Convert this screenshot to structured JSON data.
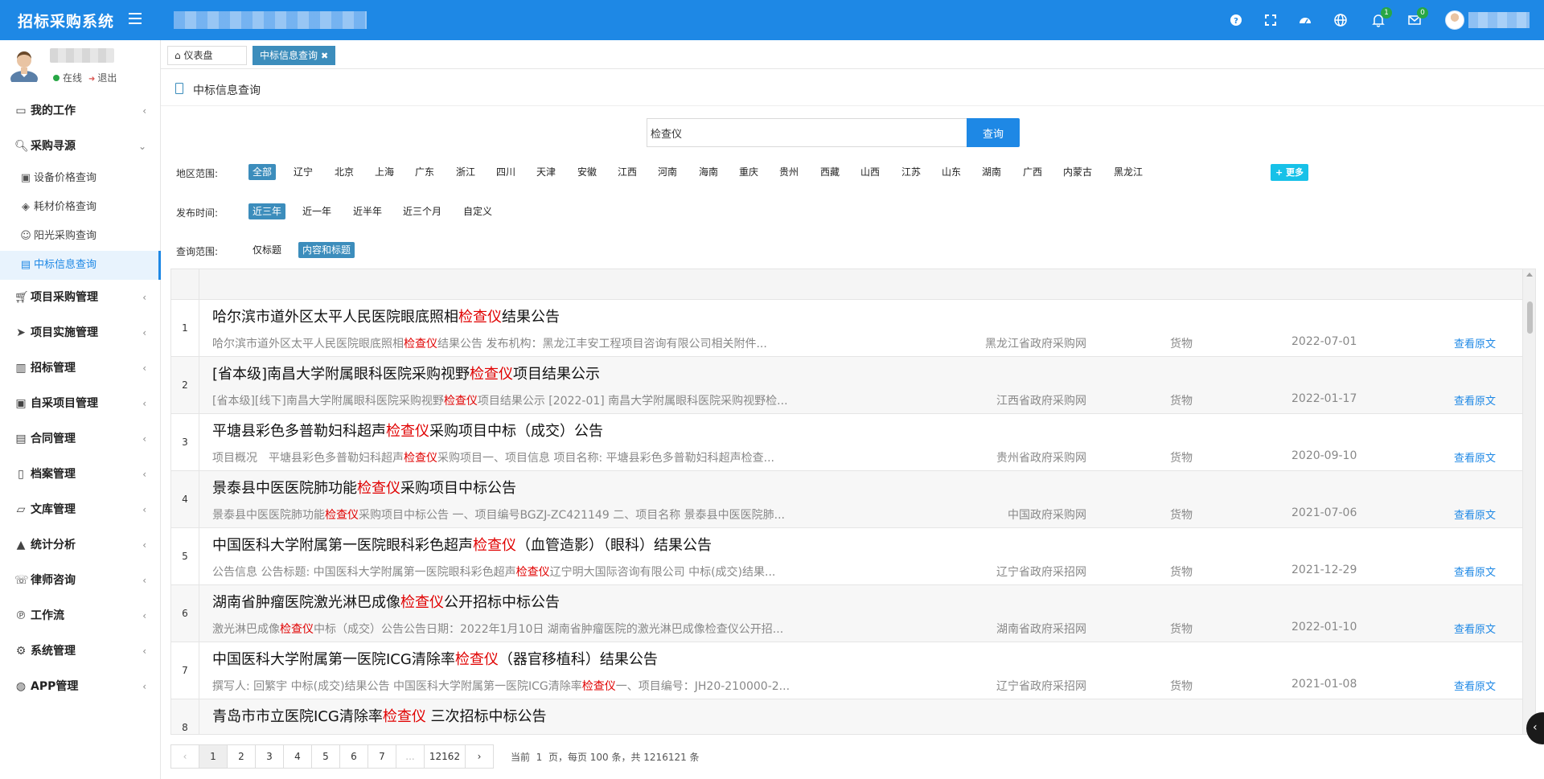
{
  "app": {
    "title": "招标采购系统"
  },
  "topbar": {
    "icons": [
      "help-icon",
      "fullscreen-icon",
      "dashboard-icon",
      "globe-icon",
      "bell-icon",
      "mail-icon"
    ],
    "bell_badge": "1",
    "mail_badge": "0"
  },
  "user": {
    "status_online": "在线",
    "logout": "退出"
  },
  "sidebar": {
    "items": [
      {
        "label": "我的工作",
        "icon": "monitor-icon"
      },
      {
        "label": "采购寻源",
        "icon": "search-icon"
      },
      {
        "label": "项目采购管理",
        "icon": "cart-icon"
      },
      {
        "label": "项目实施管理",
        "icon": "send-icon"
      },
      {
        "label": "招标管理",
        "icon": "map-icon"
      },
      {
        "label": "自采项目管理",
        "icon": "id-card-icon"
      },
      {
        "label": "合同管理",
        "icon": "doc-icon"
      },
      {
        "label": "档案管理",
        "icon": "archive-icon"
      },
      {
        "label": "文库管理",
        "icon": "folder-icon"
      },
      {
        "label": "统计分析",
        "icon": "chart-icon"
      },
      {
        "label": "律师咨询",
        "icon": "phone-icon"
      },
      {
        "label": "工作流",
        "icon": "workflow-icon"
      },
      {
        "label": "系统管理",
        "icon": "gear-icon"
      },
      {
        "label": "APP管理",
        "icon": "globe-icon"
      }
    ],
    "sub_items": [
      {
        "label": "设备价格查询",
        "icon": "camera-icon"
      },
      {
        "label": "耗材价格查询",
        "icon": "layers-icon"
      },
      {
        "label": "阳光采购查询",
        "icon": "smile-icon"
      },
      {
        "label": "中标信息查询",
        "icon": "book-icon"
      }
    ]
  },
  "tabs": [
    {
      "label": "仪表盘",
      "icon": "home-icon"
    },
    {
      "label": "中标信息查询",
      "close": "✖"
    }
  ],
  "page": {
    "title": "中标信息查询"
  },
  "search": {
    "value": "检查仪",
    "button": "查询"
  },
  "filters": {
    "region_label": "地区范围:",
    "regions": [
      "全部",
      "辽宁",
      "北京",
      "上海",
      "广东",
      "浙江",
      "四川",
      "天津",
      "安徽",
      "江西",
      "河南",
      "海南",
      "重庆",
      "贵州",
      "西藏",
      "山西",
      "江苏",
      "山东",
      "湖南",
      "广西",
      "内蒙古",
      "黑龙江"
    ],
    "more": "+ 更多",
    "time_label": "发布时间:",
    "times": [
      "近三年",
      "近一年",
      "近半年",
      "近三个月",
      "自定义"
    ],
    "scope_label": "查询范围:",
    "scopes": [
      "仅标题",
      "内容和标题"
    ]
  },
  "table": {
    "view_label": "查看原文",
    "rows": [
      {
        "num": "1",
        "title_pre": "哈尔滨市道外区太平人民医院眼底照相",
        "title_hl": "检查仪",
        "title_post": "结果公告",
        "desc_pre": "哈尔滨市道外区太平人民医院眼底照相",
        "desc_hl": "检查仪",
        "desc_post": "结果公告 发布机构：黑龙江丰安工程项目咨询有限公司相关附件...",
        "source": "黑龙江省政府采购网",
        "category": "货物",
        "date": "2022-07-01"
      },
      {
        "num": "2",
        "title_pre": "[省本级]南昌大学附属眼科医院采购视野",
        "title_hl": "检查仪",
        "title_post": "项目结果公示",
        "desc_pre": "[省本级][线下]南昌大学附属眼科医院采购视野",
        "desc_hl": "检查仪",
        "desc_post": "项目结果公示 [2022-01] 南昌大学附属眼科医院采购视野检...",
        "source": "江西省政府采购网",
        "category": "货物",
        "date": "2022-01-17"
      },
      {
        "num": "3",
        "title_pre": "平塘县彩色多普勒妇科超声",
        "title_hl": "检查仪",
        "title_post": "采购项目中标（成交）公告",
        "desc_pre": "项目概况　平塘县彩色多普勒妇科超声",
        "desc_hl": "检查仪",
        "desc_post": "采购项目一、项目信息 项目名称: 平塘县彩色多普勒妇科超声检查...",
        "source": "贵州省政府采购网",
        "category": "货物",
        "date": "2020-09-10"
      },
      {
        "num": "4",
        "title_pre": "景泰县中医医院肺功能",
        "title_hl": "检查仪",
        "title_post": "采购项目中标公告",
        "desc_pre": "景泰县中医医院肺功能",
        "desc_hl": "检查仪",
        "desc_post": "采购项目中标公告 一、项目编号BGZJ-ZC421149 二、项目名称 景泰县中医医院肺...",
        "source": "中国政府采购网",
        "category": "货物",
        "date": "2021-07-06"
      },
      {
        "num": "5",
        "title_pre": "中国医科大学附属第一医院眼科彩色超声",
        "title_hl": "检查仪",
        "title_post": "（血管造影）（眼科）结果公告",
        "desc_pre": "公告信息 公告标题: 中国医科大学附属第一医院眼科彩色超声",
        "desc_hl": "检查仪",
        "desc_post": "辽宁明大国际咨询有限公司 中标(成交)结果...",
        "source": "辽宁省政府采招网",
        "category": "货物",
        "date": "2021-12-29"
      },
      {
        "num": "6",
        "title_pre": "湖南省肿瘤医院激光淋巴成像",
        "title_hl": "检查仪",
        "title_post": "公开招标中标公告",
        "desc_pre": "激光淋巴成像",
        "desc_hl": "检查仪",
        "desc_post": "中标（成交）公告公告日期：2022年1月10日 湖南省肿瘤医院的激光淋巴成像检查仪公开招...",
        "source": "湖南省政府采招网",
        "category": "货物",
        "date": "2022-01-10"
      },
      {
        "num": "7",
        "title_pre": "中国医科大学附属第一医院ICG清除率",
        "title_hl": "检查仪",
        "title_post": "（器官移植科）结果公告",
        "desc_pre": "撰写人: 回繁宇 中标(成交)结果公告 中国医科大学附属第一医院ICG清除率",
        "desc_hl": "检查仪",
        "desc_post": "一、项目编号：JH20-210000-2...",
        "source": "辽宁省政府采招网",
        "category": "货物",
        "date": "2021-01-08"
      },
      {
        "num": "8",
        "title_pre": "青岛市市立医院ICG清除率",
        "title_hl": "检查仪",
        "title_post": " 三次招标中标公告",
        "desc_pre": "",
        "desc_hl": "",
        "desc_post": "",
        "source": "",
        "category": "",
        "date": ""
      }
    ]
  },
  "pagination": {
    "prev": "‹",
    "next": "›",
    "pages": [
      "1",
      "2",
      "3",
      "4",
      "5",
      "6",
      "7",
      "...",
      "12162"
    ],
    "current": "1",
    "info_prefix": "当前",
    "info_current": "1",
    "info_suffix": "页，每页 100 条，共 1216121 条"
  },
  "colors": {
    "primary": "#1e88e5",
    "highlight": "#e00000",
    "chip_active": "#3c8dbc"
  }
}
